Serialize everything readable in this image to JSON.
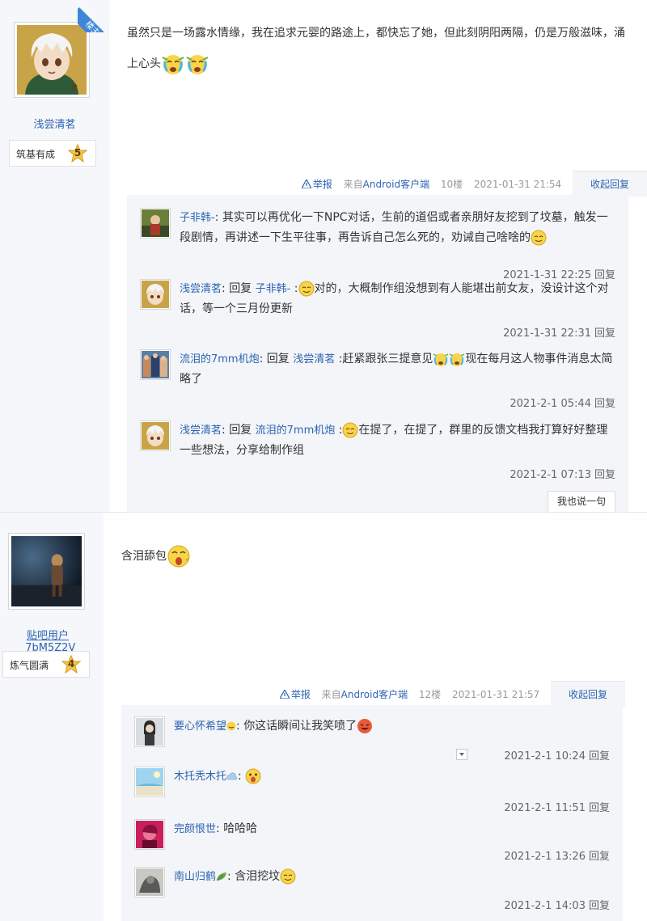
{
  "posts": [
    {
      "badge": "楼主",
      "user": {
        "name": "浅尝清茗",
        "level_name": "筑基有成",
        "level_num": "5"
      },
      "content": {
        "text": "虽然只是一场露水情缘，我在追求元婴的路途上，都快忘了她，但此刻阴阳两隔，仍是万般滋味，涌上心头",
        "emojis": [
          "crying-face-icon",
          "crying-face-icon"
        ]
      },
      "tail": {
        "report": "举报",
        "client_prefix": "来自",
        "client": "Android客户端",
        "floor": "10楼",
        "time": "2021-01-31 21:54",
        "fold": "收起回复"
      },
      "replies": [
        {
          "user": "子非韩-",
          "text": "其实可以再优化一下NPC对话，生前的道侣或者亲朋好友挖到了坟墓，触发一段剧情，再讲述一下生平往事，再告诉自己怎么死的，劝诫自己啥啥的",
          "time": "2021-1-31 22:25",
          "reply": "回复"
        },
        {
          "user": "浅尝清茗",
          "reply_to_prefix": "回复",
          "reply_to": "子非韩-",
          "text": "对的，大概制作组没想到有人能堪出前女友，没设计这个对话，等一个三月份更新",
          "time": "2021-1-31 22:31",
          "reply": "回复"
        },
        {
          "user": "流泪的7mm机炮",
          "reply_to_prefix": "回复",
          "reply_to": "浅尝清茗",
          "text_a": "赶紧跟张三提意见",
          "text_b": "现在每月这人物事件消息太简略了",
          "time": "2021-2-1 05:44",
          "reply": "回复"
        },
        {
          "user": "浅尝清茗",
          "reply_to_prefix": "回复",
          "reply_to": "流泪的7mm机炮",
          "text": "在提了，在提了，群里的反馈文档我打算好好整理一些想法，分享给制作组",
          "time": "2021-2-1 07:13",
          "reply": "回复"
        }
      ],
      "say_button": "我也说一句"
    },
    {
      "user": {
        "name": "贴吧用户_7bM5Z2V",
        "level_name": "炼气圆满",
        "level_num": "4"
      },
      "content": {
        "text": "含泪舔包",
        "emojis": [
          "surprised-face-icon"
        ]
      },
      "tail": {
        "report": "举报",
        "client_prefix": "来自",
        "client": "Android客户端",
        "floor": "12楼",
        "time": "2021-01-31 21:57",
        "fold": "收起回复"
      },
      "replies": [
        {
          "user": "要心怀希望",
          "text": "你这话瞬间让我笑喷了",
          "time": "2021-2-1 10:24",
          "reply": "回复"
        },
        {
          "user": "木托秃木托",
          "text": "",
          "time": "2021-2-1 11:51",
          "reply": "回复"
        },
        {
          "user": "完颜恨世",
          "text": "哈哈哈",
          "time": "2021-2-1 13:26",
          "reply": "回复"
        },
        {
          "user": "南山归鹤",
          "text": "含泪挖坟",
          "time": "2021-2-1 14:03",
          "reply": "回复"
        }
      ]
    }
  ],
  "colors": {
    "link": "#2d64b3",
    "sidebar_bg": "#f5f7fa",
    "lzl_bg": "#f3f5f8",
    "badge": "#3e87d8"
  }
}
